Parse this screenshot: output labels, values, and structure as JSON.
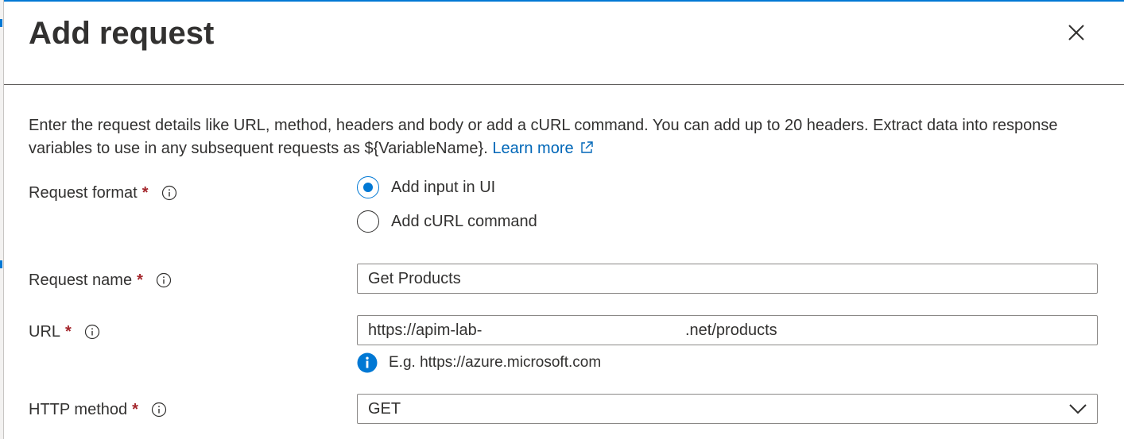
{
  "panel": {
    "title": "Add request",
    "close_label": "Close",
    "description_text": "Enter the request details like URL, method, headers and body or add a cURL command. You can add up to 20 headers. Extract data into response variables to use in any subsequent requests as ${VariableName}.",
    "learn_more_label": "Learn more"
  },
  "fields": {
    "request_format": {
      "label": "Request format",
      "required_mark": "*",
      "options": [
        {
          "label": "Add input in UI",
          "selected": true
        },
        {
          "label": "Add cURL command",
          "selected": false
        }
      ]
    },
    "request_name": {
      "label": "Request name",
      "required_mark": "*",
      "value": "Get Products"
    },
    "url": {
      "label": "URL",
      "required_mark": "*",
      "value": "https://apim-lab-                                              .net/products",
      "hint": "E.g. https://azure.microsoft.com"
    },
    "http_method": {
      "label": "HTTP method",
      "required_mark": "*",
      "value": "GET"
    }
  },
  "colors": {
    "accent": "#0078d4",
    "link": "#0067b8",
    "required": "#a4262c",
    "border": "#8a8886",
    "text": "#323130"
  },
  "icons": {
    "close": "close-icon",
    "info": "info-icon",
    "external_link": "external-link-icon",
    "hint_info": "info-filled-icon",
    "chevron": "chevron-down-icon"
  }
}
